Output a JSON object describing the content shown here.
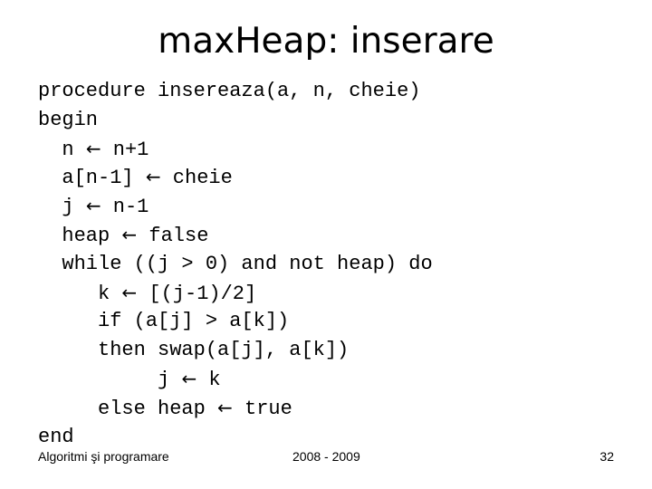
{
  "slide": {
    "title": "maxHeap: inserare",
    "code_lines": [
      {
        "indent": "",
        "pre": "procedure insereaza(a, n, cheie)",
        "arrow": "",
        "post": ""
      },
      {
        "indent": "",
        "pre": "begin",
        "arrow": "",
        "post": ""
      },
      {
        "indent": "  ",
        "pre": "n ",
        "arrow": "←",
        "post": " n+1"
      },
      {
        "indent": "  ",
        "pre": "a[n-1] ",
        "arrow": "←",
        "post": " cheie"
      },
      {
        "indent": "  ",
        "pre": "j ",
        "arrow": "←",
        "post": " n-1"
      },
      {
        "indent": "  ",
        "pre": "heap ",
        "arrow": "←",
        "post": " false"
      },
      {
        "indent": "  ",
        "pre": "while ((j > 0) and not heap) do",
        "arrow": "",
        "post": ""
      },
      {
        "indent": "     ",
        "pre": "k ",
        "arrow": "←",
        "post": " [(j-1)/2]"
      },
      {
        "indent": "     ",
        "pre": "if (a[j] > a[k])",
        "arrow": "",
        "post": ""
      },
      {
        "indent": "     ",
        "pre": "then swap(a[j], a[k])",
        "arrow": "",
        "post": ""
      },
      {
        "indent": "          ",
        "pre": "j ",
        "arrow": "←",
        "post": " k"
      },
      {
        "indent": "     ",
        "pre": "else heap ",
        "arrow": "←",
        "post": " true"
      },
      {
        "indent": "",
        "pre": "end",
        "arrow": "",
        "post": ""
      }
    ]
  },
  "footer": {
    "course": "Algoritmi şi programare",
    "year": "2008 - 2009",
    "page_number": "32"
  }
}
